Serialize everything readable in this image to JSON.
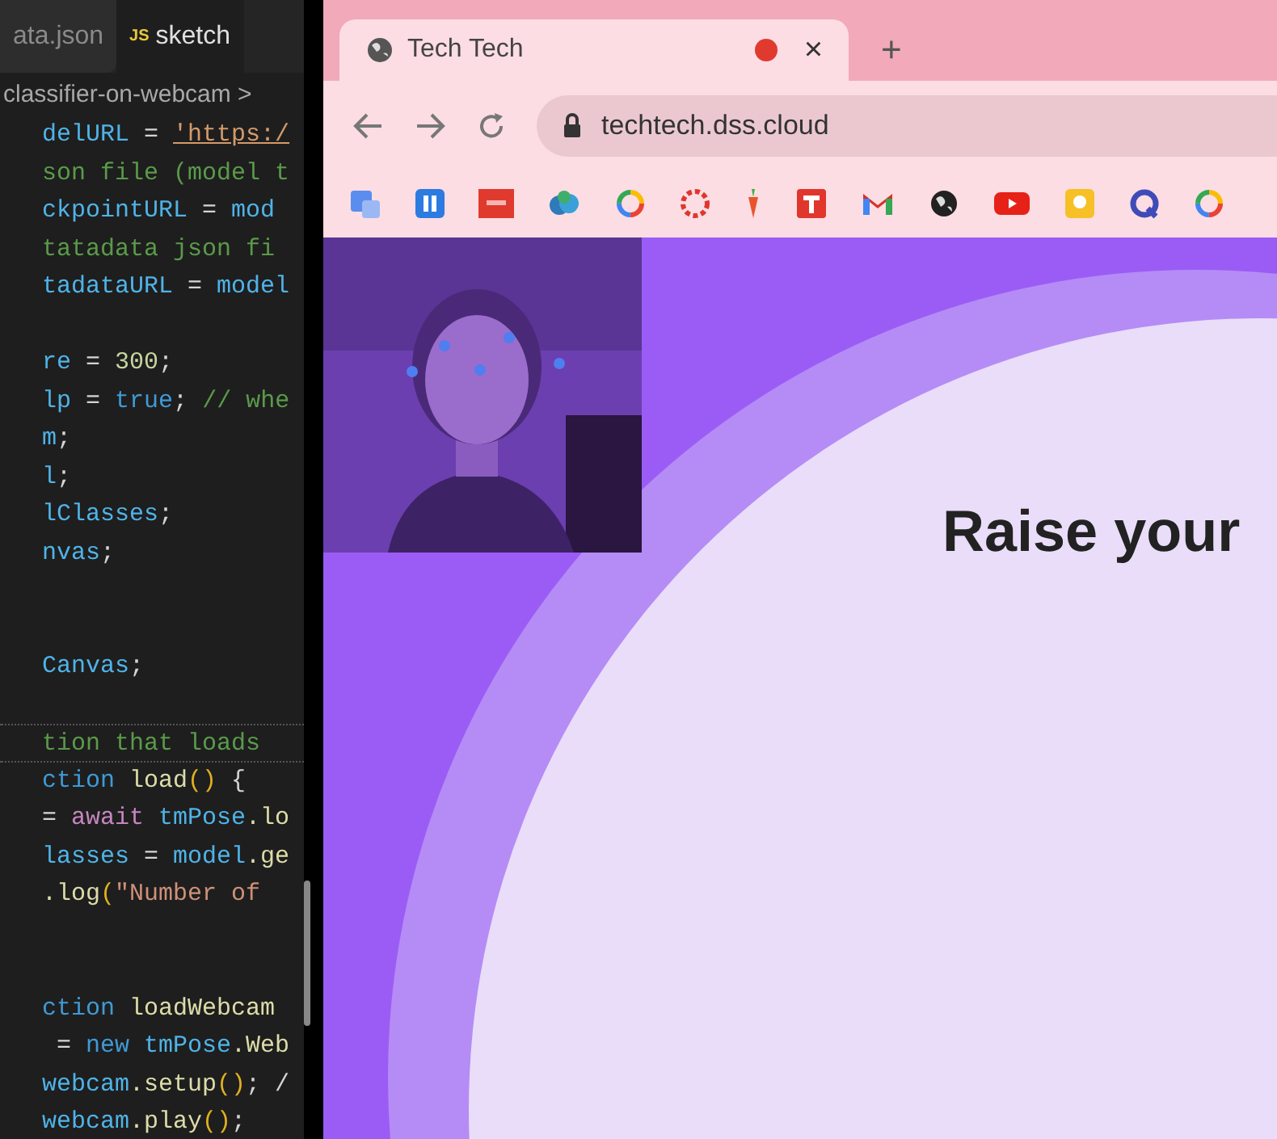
{
  "editor": {
    "tabs": [
      {
        "label": "ata.json",
        "selected": false
      },
      {
        "label": "sketch",
        "badge": "JS",
        "selected": true
      }
    ],
    "breadcrumb": "classifier-on-webcam >",
    "lines": [
      {
        "kind": "code",
        "current": false,
        "tokens": [
          {
            "text": "delURL",
            "kind": "var"
          },
          {
            "text": " = ",
            "kind": "op"
          },
          {
            "text": "'https:/",
            "kind": "link"
          }
        ]
      },
      {
        "kind": "code",
        "current": false,
        "tokens": [
          {
            "text": "son file (model t",
            "kind": "comment"
          }
        ]
      },
      {
        "kind": "code",
        "current": false,
        "tokens": [
          {
            "text": "ckpointURL",
            "kind": "var"
          },
          {
            "text": " = ",
            "kind": "op"
          },
          {
            "text": "mod",
            "kind": "var"
          }
        ]
      },
      {
        "kind": "code",
        "current": false,
        "tokens": [
          {
            "text": "tatadata json fi",
            "kind": "comment"
          }
        ]
      },
      {
        "kind": "code",
        "current": false,
        "tokens": [
          {
            "text": "tadataURL",
            "kind": "var"
          },
          {
            "text": " = ",
            "kind": "op"
          },
          {
            "text": "model",
            "kind": "var"
          }
        ]
      },
      {
        "kind": "blank"
      },
      {
        "kind": "code",
        "current": false,
        "tokens": [
          {
            "text": "re",
            "kind": "var"
          },
          {
            "text": " = ",
            "kind": "op"
          },
          {
            "text": "300",
            "kind": "number"
          },
          {
            "text": ";",
            "kind": "op"
          }
        ]
      },
      {
        "kind": "code",
        "current": false,
        "tokens": [
          {
            "text": "lp",
            "kind": "var"
          },
          {
            "text": " = ",
            "kind": "op"
          },
          {
            "text": "true",
            "kind": "keyword"
          },
          {
            "text": "; ",
            "kind": "op"
          },
          {
            "text": "// whe",
            "kind": "comment"
          }
        ]
      },
      {
        "kind": "code",
        "current": false,
        "tokens": [
          {
            "text": "m",
            "kind": "var"
          },
          {
            "text": ";",
            "kind": "op"
          }
        ]
      },
      {
        "kind": "code",
        "current": false,
        "tokens": [
          {
            "text": "l",
            "kind": "var"
          },
          {
            "text": ";",
            "kind": "op"
          }
        ]
      },
      {
        "kind": "code",
        "current": false,
        "tokens": [
          {
            "text": "lClasses",
            "kind": "var"
          },
          {
            "text": ";",
            "kind": "op"
          }
        ]
      },
      {
        "kind": "code",
        "current": false,
        "tokens": [
          {
            "text": "nvas",
            "kind": "var"
          },
          {
            "text": ";",
            "kind": "op"
          }
        ]
      },
      {
        "kind": "blank"
      },
      {
        "kind": "blank"
      },
      {
        "kind": "code",
        "current": false,
        "tokens": [
          {
            "text": "Canvas",
            "kind": "var"
          },
          {
            "text": ";",
            "kind": "op"
          }
        ]
      },
      {
        "kind": "blank"
      },
      {
        "kind": "code",
        "current": true,
        "tokens": [
          {
            "text": "tion that loads",
            "kind": "comment"
          }
        ]
      },
      {
        "kind": "code",
        "current": false,
        "tokens": [
          {
            "text": "ction ",
            "kind": "keyword"
          },
          {
            "text": "load",
            "kind": "fn"
          },
          {
            "text": "()",
            "kind": "paren"
          },
          {
            "text": " {",
            "kind": "op"
          }
        ]
      },
      {
        "kind": "code",
        "current": false,
        "tokens": [
          {
            "text": "= ",
            "kind": "op"
          },
          {
            "text": "await ",
            "kind": "control"
          },
          {
            "text": "tmPose",
            "kind": "var"
          },
          {
            "text": ".lo",
            "kind": "fn"
          }
        ]
      },
      {
        "kind": "code",
        "current": false,
        "tokens": [
          {
            "text": "lasses",
            "kind": "var"
          },
          {
            "text": " = ",
            "kind": "op"
          },
          {
            "text": "model",
            "kind": "var"
          },
          {
            "text": ".ge",
            "kind": "fn"
          }
        ]
      },
      {
        "kind": "code",
        "current": false,
        "tokens": [
          {
            "text": ".log",
            "kind": "fn"
          },
          {
            "text": "(",
            "kind": "paren"
          },
          {
            "text": "\"Number of",
            "kind": "string"
          }
        ]
      },
      {
        "kind": "blank"
      },
      {
        "kind": "blank"
      },
      {
        "kind": "code",
        "current": false,
        "tokens": [
          {
            "text": "ction ",
            "kind": "keyword"
          },
          {
            "text": "loadWebcam",
            "kind": "fn"
          }
        ]
      },
      {
        "kind": "code",
        "current": false,
        "tokens": [
          {
            "text": " = ",
            "kind": "op"
          },
          {
            "text": "new ",
            "kind": "keyword"
          },
          {
            "text": "tmPose",
            "kind": "var"
          },
          {
            "text": ".Web",
            "kind": "fn"
          }
        ]
      },
      {
        "kind": "code",
        "current": false,
        "tokens": [
          {
            "text": "webcam",
            "kind": "var"
          },
          {
            "text": ".setup",
            "kind": "fn"
          },
          {
            "text": "()",
            "kind": "paren"
          },
          {
            "text": "; /",
            "kind": "op"
          }
        ]
      },
      {
        "kind": "code",
        "current": false,
        "tokens": [
          {
            "text": "webcam",
            "kind": "var"
          },
          {
            "text": ".play",
            "kind": "fn"
          },
          {
            "text": "()",
            "kind": "paren"
          },
          {
            "text": ";",
            "kind": "op"
          }
        ]
      }
    ]
  },
  "browser": {
    "tab": {
      "title": "Tech Tech",
      "recording": true,
      "close": "×"
    },
    "new_tab": "+",
    "address": "techtech.dss.cloud",
    "page": {
      "heading": "Raise your"
    }
  }
}
